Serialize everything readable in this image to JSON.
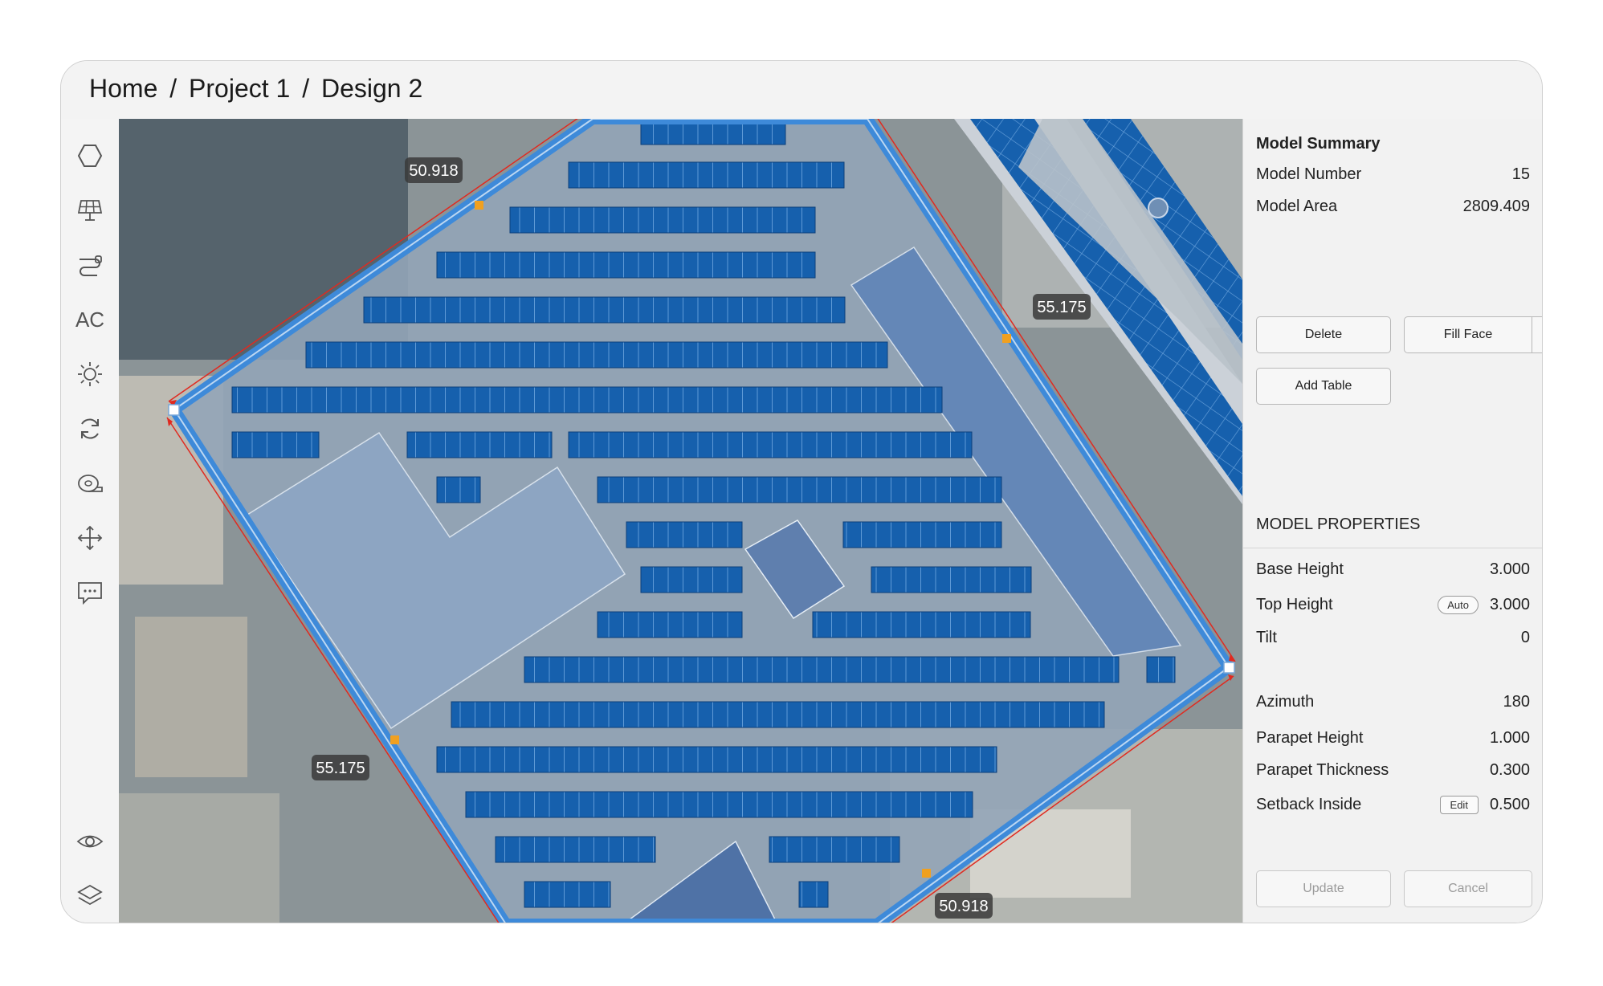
{
  "breadcrumb": [
    "Home",
    "/",
    "Project 1",
    "/",
    "Design 2"
  ],
  "toolbar": {
    "tools": [
      "polygon-icon",
      "solar-panel-icon",
      "wiring-icon",
      "ac-icon",
      "sun-icon",
      "refresh-icon",
      "tape-measure-icon",
      "move-icon",
      "comment-icon",
      "eye-icon",
      "layers-icon",
      "wrench-icon"
    ],
    "ac_label": "AC"
  },
  "canvas": {
    "dimensions": {
      "top_left": "50.918",
      "top_right": "55.175",
      "bottom_left": "55.175",
      "bottom_right": "50.918"
    }
  },
  "panel": {
    "summary_title": "Model Summary",
    "model_number_label": "Model Number",
    "model_number": "15",
    "model_area_label": "Model Area",
    "model_area": "2809.409",
    "delete_label": "Delete",
    "fill_face_label": "Fill Face",
    "add_table_label": "Add Table",
    "properties_title": "MODEL PROPERTIES",
    "base_height_label": "Base Height",
    "base_height": "3.000",
    "top_height_label": "Top Height",
    "top_height_mode": "Auto",
    "top_height": "3.000",
    "tilt_label": "Tilt",
    "tilt": "0",
    "azimuth_label": "Azimuth",
    "azimuth": "180",
    "parapet_height_label": "Parapet Height",
    "parapet_height": "1.000",
    "parapet_thickness_label": "Parapet Thickness",
    "parapet_thickness": "0.300",
    "setback_inside_label": "Setback Inside",
    "setback_edit_label": "Edit",
    "setback_inside": "0.500",
    "update_label": "Update",
    "cancel_label": "Cancel"
  }
}
